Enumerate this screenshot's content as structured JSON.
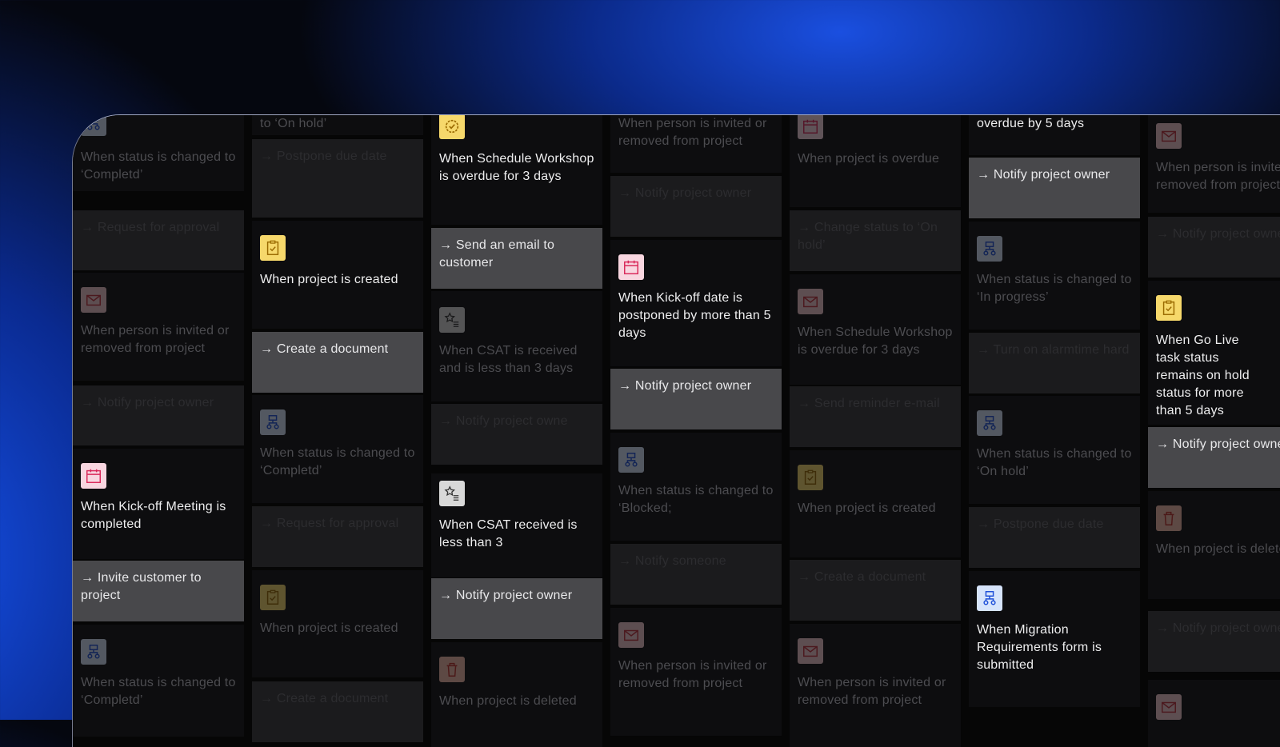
{
  "columns": [
    {
      "cells": [
        {
          "kind": "trigger",
          "icon": "flow-icon",
          "text": "When status is changed to ‘Completd’",
          "bright": false
        },
        {
          "kind": "action",
          "text": "→ Request for approval",
          "highlight": false
        },
        {
          "kind": "trigger",
          "icon": "mail-icon",
          "text": "When person is invited or removed from project",
          "bright": false
        },
        {
          "kind": "action",
          "text": "→ Notify project owner",
          "highlight": false
        },
        {
          "kind": "trigger",
          "icon": "calendar-icon",
          "text": "When Kick-off Meeting is completed",
          "bright": true
        },
        {
          "kind": "action",
          "text": "→ Invite customer to project",
          "highlight": true
        },
        {
          "kind": "trigger",
          "icon": "flow-icon",
          "text": "When status is changed to ‘Completd’",
          "bright": false
        }
      ]
    },
    {
      "cells": [
        {
          "kind": "trigger",
          "icon": "",
          "text": "to ‘On hold’",
          "bright": false
        },
        {
          "kind": "action",
          "text": "→ Postpone due date",
          "highlight": false
        },
        {
          "kind": "trigger",
          "icon": "clipboard-icon",
          "text": "When project is created",
          "bright": true
        },
        {
          "kind": "action",
          "text": "→ Create a document",
          "highlight": true
        },
        {
          "kind": "trigger",
          "icon": "flow-icon",
          "text": "When status is changed to ‘Completd’",
          "bright": false
        },
        {
          "kind": "action",
          "text": "→ Request for approval",
          "highlight": false
        },
        {
          "kind": "trigger",
          "icon": "clipboard-icon",
          "text": "When project is created",
          "bright": false
        },
        {
          "kind": "action",
          "text": "→ Create a document",
          "highlight": false
        }
      ]
    },
    {
      "cells": [
        {
          "kind": "trigger",
          "icon": "badge-check-icon",
          "text": "When Schedule Workshop is overdue for 3 days",
          "bright": true
        },
        {
          "kind": "action",
          "text": "→ Send an email to customer",
          "highlight": true
        },
        {
          "kind": "trigger",
          "icon": "star-list-icon",
          "text": "When CSAT is received and is less than 3 days",
          "bright": false
        },
        {
          "kind": "action",
          "text": "→ Notify project owne",
          "highlight": false
        },
        {
          "kind": "trigger",
          "icon": "star-list-icon",
          "text": "When CSAT received is less than 3",
          "bright": true
        },
        {
          "kind": "action",
          "text": "→ Notify project owner",
          "highlight": true
        },
        {
          "kind": "trigger",
          "icon": "trash-icon",
          "text": "When project is deleted",
          "bright": false
        }
      ]
    },
    {
      "cells": [
        {
          "kind": "trigger",
          "icon": "",
          "text": "When person is invited or removed from project",
          "bright": false
        },
        {
          "kind": "action",
          "text": "→ Notify project owner",
          "highlight": false
        },
        {
          "kind": "trigger",
          "icon": "calendar-icon",
          "text": "When Kick-off date is postponed by more than 5 days",
          "bright": true
        },
        {
          "kind": "action",
          "text": "→ Notify project owner",
          "highlight": true
        },
        {
          "kind": "trigger",
          "icon": "flow-icon",
          "text": "When status is changed to ‘Blocked;",
          "bright": false
        },
        {
          "kind": "action",
          "text": "→ Notify someone",
          "highlight": false
        },
        {
          "kind": "trigger",
          "icon": "mail-icon",
          "text": "When person is invited or removed from project",
          "bright": false
        }
      ]
    },
    {
      "cells": [
        {
          "kind": "trigger",
          "icon": "calendar-icon",
          "text": "When project is overdue",
          "bright": false
        },
        {
          "kind": "action",
          "text": "→ Change status to ‘On hold’",
          "highlight": false
        },
        {
          "kind": "trigger",
          "icon": "mail-icon",
          "text": "When Schedule Workshop is overdue for 3 days",
          "bright": false
        },
        {
          "kind": "action",
          "text": "→ Send reminder e-mail",
          "highlight": false
        },
        {
          "kind": "trigger",
          "icon": "clipboard-icon",
          "text": "When project is created",
          "bright": false
        },
        {
          "kind": "action",
          "text": "→ Create a document",
          "highlight": false
        },
        {
          "kind": "trigger",
          "icon": "mail-icon",
          "text": "When person is invited or removed from project",
          "bright": false
        }
      ]
    },
    {
      "cells": [
        {
          "kind": "trigger",
          "icon": "",
          "text": "overdue by 5 days",
          "bright": true
        },
        {
          "kind": "action",
          "text": "→ Notify project owner",
          "highlight": true
        },
        {
          "kind": "trigger",
          "icon": "flow-icon",
          "text": "When status is changed to ‘In progress’",
          "bright": false
        },
        {
          "kind": "action",
          "text": "→ Turn on alarmtime hard",
          "highlight": false
        },
        {
          "kind": "trigger",
          "icon": "flow-icon",
          "text": "When status is changed to ‘On hold’",
          "bright": false
        },
        {
          "kind": "action",
          "text": "→ Postpone due date",
          "highlight": false
        },
        {
          "kind": "trigger",
          "icon": "flow-icon",
          "text": "When Migration Requirements form is submitted",
          "bright": true
        }
      ]
    },
    {
      "cells": [
        {
          "kind": "trigger",
          "icon": "mail-icon",
          "text": "When person is invited or removed from project",
          "bright": false
        },
        {
          "kind": "action",
          "text": "→ Notify project owner",
          "highlight": false
        },
        {
          "kind": "trigger",
          "icon": "clipboard-icon",
          "text": "When Go Live task status remains on hold status for more than 5 days",
          "bright": true
        },
        {
          "kind": "action",
          "text": "→ Notify project owner",
          "highlight": true
        },
        {
          "kind": "trigger",
          "icon": "trash-icon",
          "text": "When project is deleted",
          "bright": false
        },
        {
          "kind": "action",
          "text": "→ Notify project owner",
          "highlight": false
        },
        {
          "kind": "trigger",
          "icon": "mail-icon",
          "text": "",
          "bright": false
        }
      ]
    }
  ]
}
